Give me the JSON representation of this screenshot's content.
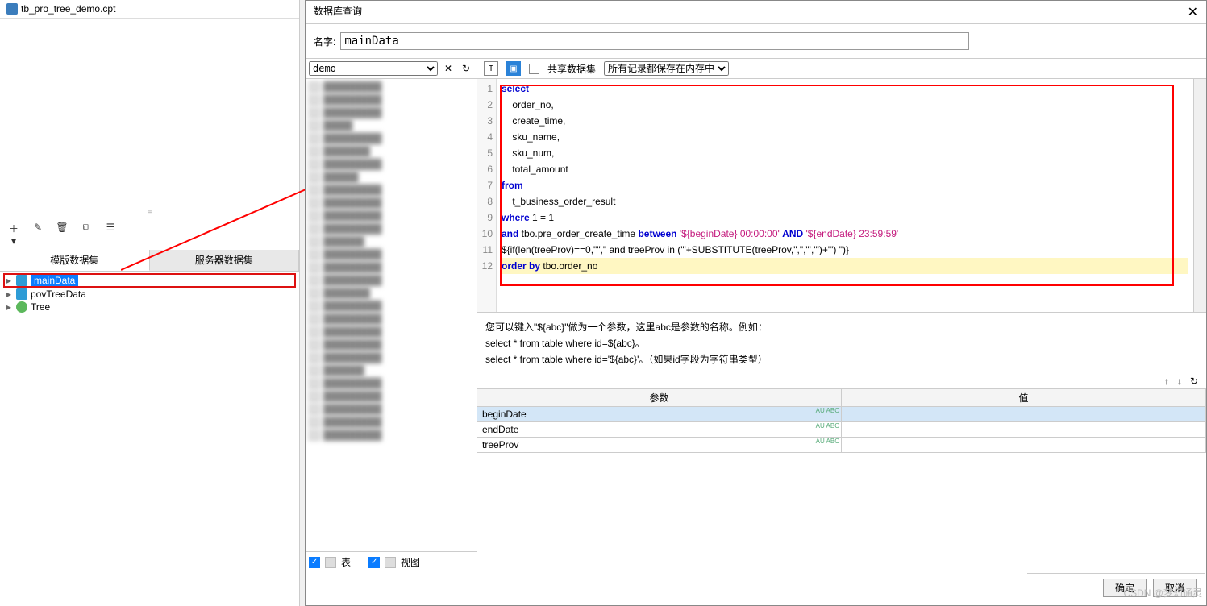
{
  "file": {
    "name": "tb_pro_tree_demo.cpt"
  },
  "ds_tabs": {
    "template": "模版数据集",
    "server": "服务器数据集"
  },
  "datasets": [
    {
      "name": "mainData",
      "type": "db",
      "selected": true
    },
    {
      "name": "povTreeData",
      "type": "db"
    },
    {
      "name": "Tree",
      "type": "tree"
    }
  ],
  "dialog": {
    "title": "数据库查询",
    "name_label": "名字:",
    "name_value": "mainData",
    "connection": "demo",
    "share_label": "共享数据集",
    "record_mode": "所有记录都保存在内存中",
    "hint_line1": "您可以键入\"${abc}\"做为一个参数，这里abc是参数的名称。例如：",
    "hint_line2": "select * from table where id=${abc}。",
    "hint_line3": "select * from table where id='${abc}'。（如果id字段为字符串类型）",
    "param_header": {
      "name": "参数",
      "value": "值"
    },
    "params": [
      {
        "name": "beginDate",
        "value": ""
      },
      {
        "name": "endDate",
        "value": ""
      },
      {
        "name": "treeProv",
        "value": ""
      }
    ],
    "foot": {
      "ok": "确定",
      "cancel": "取消"
    },
    "foot_checks": {
      "table": "表",
      "view": "视图"
    }
  },
  "sql": {
    "lines": [
      {
        "n": 1,
        "segs": [
          {
            "t": "select",
            "c": "kw"
          }
        ]
      },
      {
        "n": 2,
        "segs": [
          {
            "t": "    order_no,"
          }
        ]
      },
      {
        "n": 3,
        "segs": [
          {
            "t": "    create_time,"
          }
        ]
      },
      {
        "n": 4,
        "segs": [
          {
            "t": "    sku_name,"
          }
        ]
      },
      {
        "n": 5,
        "segs": [
          {
            "t": "    sku_num,"
          }
        ]
      },
      {
        "n": 6,
        "segs": [
          {
            "t": "    total_amount"
          }
        ]
      },
      {
        "n": 7,
        "segs": [
          {
            "t": "from",
            "c": "kw"
          }
        ]
      },
      {
        "n": 8,
        "segs": [
          {
            "t": "    t_business_order_result"
          }
        ]
      },
      {
        "n": 9,
        "segs": [
          {
            "t": "where",
            "c": "kw"
          },
          {
            "t": " 1 = 1"
          }
        ]
      },
      {
        "n": 10,
        "segs": [
          {
            "t": "and",
            "c": "kw"
          },
          {
            "t": " tbo.pre_order_create_time "
          },
          {
            "t": "between",
            "c": "kw"
          },
          {
            "t": " "
          },
          {
            "t": "'${beginDate} 00:00:00'",
            "c": "str"
          },
          {
            "t": " "
          },
          {
            "t": "AND",
            "c": "kw"
          },
          {
            "t": " "
          },
          {
            "t": "'${endDate} 23:59:59'",
            "c": "str"
          }
        ]
      },
      {
        "n": 11,
        "segs": [
          {
            "t": "${if(len(treeProv)==0,\"\",\" and treeProv in ('\"+SUBSTITUTE(treeProv,\",\",\"','\")+\"') \")}"
          }
        ]
      },
      {
        "n": 12,
        "cursor": true,
        "segs": [
          {
            "t": "order by",
            "c": "kw"
          },
          {
            "t": " tbo.order_no"
          }
        ]
      }
    ]
  },
  "watermark": "CSDN @梦幻通灵",
  "badge": "AU\nABC"
}
